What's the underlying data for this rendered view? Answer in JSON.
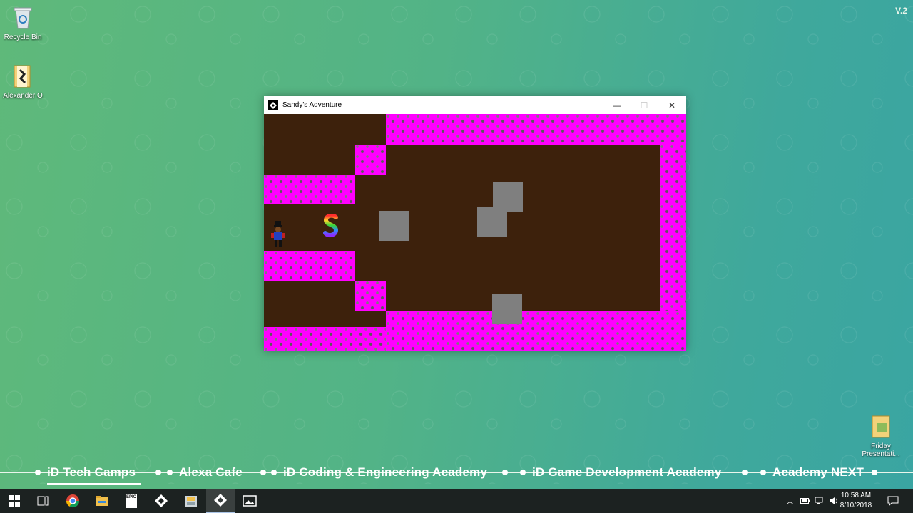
{
  "desktop": {
    "version": "V.2",
    "icons": [
      {
        "label": "Recycle Bin",
        "icon": "recycle-bin-icon"
      },
      {
        "label": "Alexander O",
        "icon": "user-folder-icon"
      },
      {
        "label": "Friday Presentati...",
        "icon": "folder-icon"
      }
    ]
  },
  "window": {
    "title": "Sandy's Adventure",
    "minimize": "—",
    "maximize": "☐",
    "close": "✕",
    "colors": {
      "floor": "#3d210c",
      "wall": "#ff00ff",
      "box": "#7f7f7f"
    }
  },
  "slogans": [
    "iD Tech Camps",
    "Alexa Cafe",
    "iD Coding & Engineering Academy",
    "iD Game Development Academy",
    "Academy NEXT"
  ],
  "taskbar": {
    "apps": [
      "start-button",
      "task-view",
      "chrome",
      "file-explorer",
      "epic-games",
      "game-maker",
      "file-explorer-2",
      "sandys-adventure",
      "photos"
    ],
    "epic_label": "EPIC",
    "time": "10:58 AM",
    "date": "8/10/2018"
  }
}
